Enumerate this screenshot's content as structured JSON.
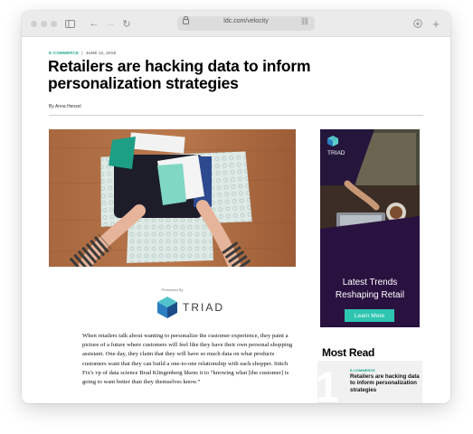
{
  "browser": {
    "url": "ldc.com/velocity",
    "buttons": {
      "sidebar": "sidebar-toggle",
      "back": "←",
      "forward": "→",
      "reload": "↻",
      "download": "⤓",
      "new_tab": "+"
    }
  },
  "article": {
    "category": "E-COMMERCE",
    "date": "JUNE 12, 2018",
    "separator": "|",
    "headline": "Retailers are hacking data to inform personalization strategies",
    "byline": "By Anna Hensel",
    "presented_by": "Presented By",
    "sponsor": "TRIAD",
    "body": "When retailers talk about wanting to personalize the customer experience, they paint a picture of a future where customers will feel like they have their own personal shopping assistant. One day, they claim that they will have so much data on what products customers want that they can build a one-to-one relationship with each shopper. Stitch Fix's vp of data science Brad Klingenberg likens it to “knowing what [the customer] is going to want better than they themselves know.”"
  },
  "ad": {
    "brand": "TRIAD",
    "headline": "Latest Trends Reshaping Retail",
    "button": "Learn More"
  },
  "most_read": {
    "heading": "Most Read",
    "items": [
      {
        "rank": "1",
        "category": "E-COMMERCE",
        "title": "Retailers are hacking data to inform personalization strategies"
      }
    ]
  },
  "colors": {
    "accent": "#1aa58a",
    "ad_background": "#2a1240",
    "ad_button": "#2ec5b0"
  }
}
